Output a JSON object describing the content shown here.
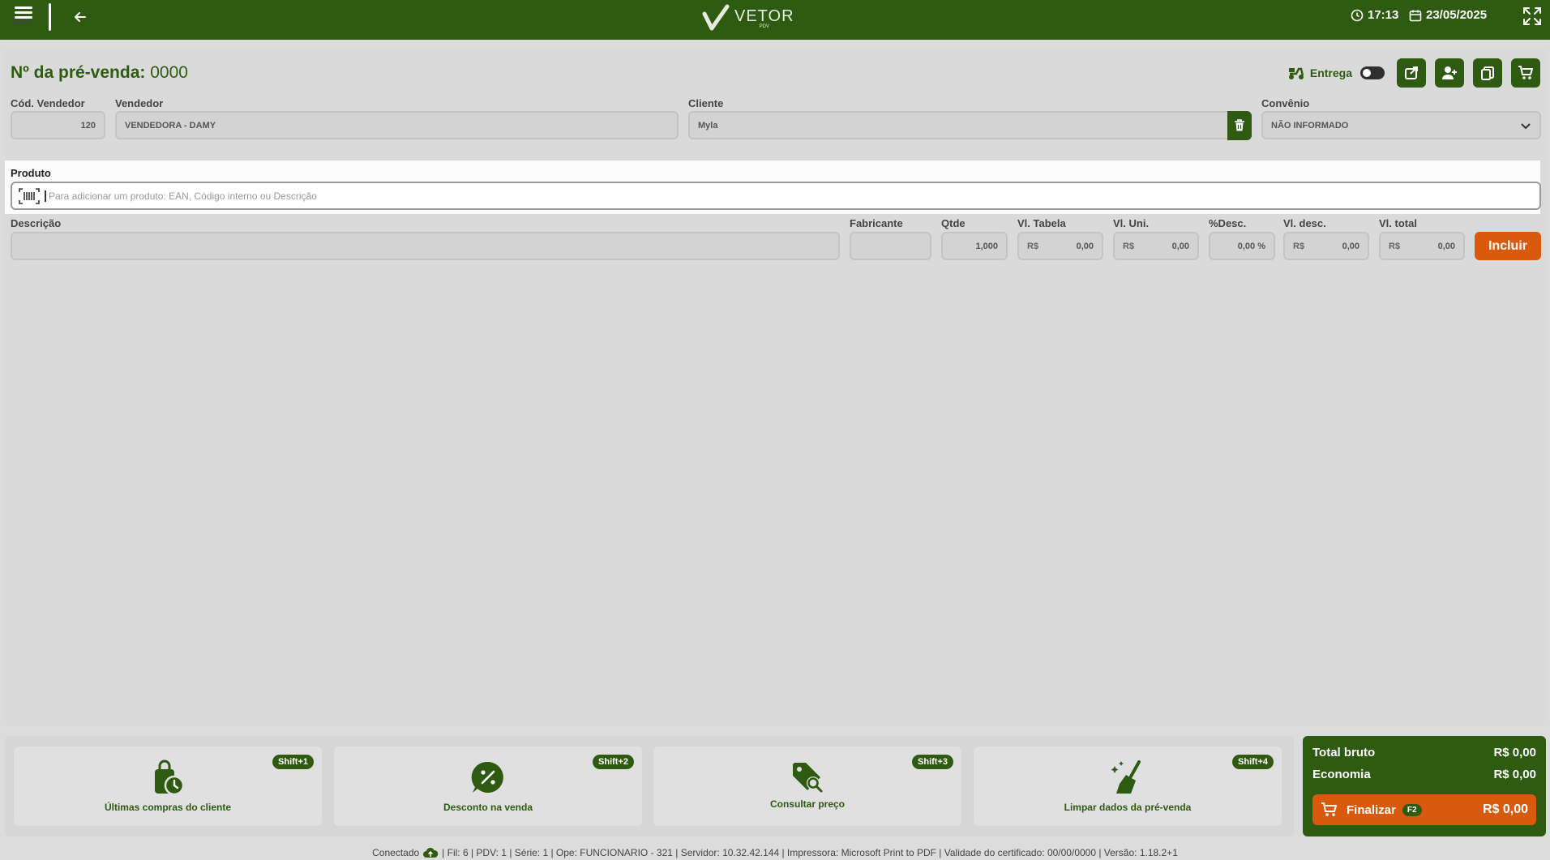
{
  "header": {
    "menu_label": "Menu",
    "logo_name": "VETOR",
    "logo_sub": "PDV",
    "time": "17:13",
    "date": "23/05/2025"
  },
  "presale": {
    "title_label": "Nº da pré-venda:",
    "number": "0000",
    "entrega_label": "Entrega"
  },
  "form": {
    "cod_vendedor_label": "Cód. Vendedor",
    "cod_vendedor_value": "120",
    "vendedor_label": "Vendedor",
    "vendedor_value": "VENDEDORA - DAMY",
    "cliente_label": "Cliente",
    "cliente_value": "Myla",
    "convenio_label": "Convênio",
    "convenio_value": "NÃO INFORMADO"
  },
  "produto": {
    "label": "Produto",
    "placeholder": "Para adicionar um produto: EAN, Código interno ou Descrição"
  },
  "item": {
    "descricao_label": "Descrição",
    "fabricante_label": "Fabricante",
    "qtde_label": "Qtde",
    "qtde_value": "1,000",
    "vl_tabela_label": "Vl. Tabela",
    "vl_tabela_value": "0,00",
    "vl_uni_label": "Vl. Uni.",
    "vl_uni_value": "0,00",
    "desc_pct_label": "%Desc.",
    "desc_pct_value": "0,00 %",
    "vl_desc_label": "Vl. desc.",
    "vl_desc_value": "0,00",
    "vl_total_label": "Vl. total",
    "vl_total_value": "0,00",
    "currency": "R$",
    "incluir_label": "Incluir"
  },
  "actions": [
    {
      "label": "Últimas compras do cliente",
      "shortcut": "Shift+1",
      "icon": "bag-clock-icon"
    },
    {
      "label": "Desconto na venda",
      "shortcut": "Shift+2",
      "icon": "discount-icon"
    },
    {
      "label": "Consultar preço",
      "shortcut": "Shift+3",
      "icon": "price-tag-search-icon"
    },
    {
      "label": "Limpar dados da pré-venda",
      "shortcut": "Shift+4",
      "icon": "broom-icon"
    }
  ],
  "totals": {
    "bruto_label": "Total bruto",
    "bruto_value": "R$ 0,00",
    "economia_label": "Economia",
    "economia_value": "R$ 0,00",
    "finalizar_label": "Finalizar",
    "finalizar_shortcut": "F2",
    "finalizar_value": "R$ 0,00"
  },
  "status": {
    "connected": "Conectado",
    "info": "| Fil: 6 | PDV: 1 | Série: 1 | Ope: FUNCIONARIO - 321 | Servidor: 10.32.42.144 | Impressora: Microsoft Print to PDF | Validade do certificado: 00/00/0000 | Versão: 1.18.2+1"
  },
  "colors": {
    "brand_green": "#2e5a12",
    "accent_orange": "#d95a0d"
  }
}
